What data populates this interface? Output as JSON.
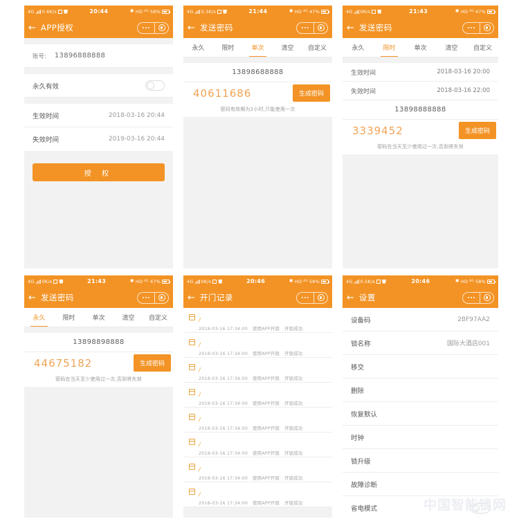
{
  "brand": {
    "accent": "#F39325",
    "code_color": "#F0A355",
    "bg": "#f2f2f2",
    "watermark": "中国智能锁网"
  },
  "icons": {
    "back": "back-arrow-icon",
    "more": "more-dots-icon",
    "target": "target-circle-icon",
    "calendar": "calendar-icon",
    "signal": "signal-bars-icon",
    "battery": "battery-icon",
    "bluetooth": "bluetooth-icon"
  },
  "panels": [
    {
      "id": "app-authorize",
      "status": {
        "net": "4G",
        "speed": "0.6K/s",
        "time": "20:44",
        "hd": "HD",
        "net2": "4G",
        "battery": "58%"
      },
      "nav": {
        "title": "APP授权"
      },
      "account": {
        "label": "账号:",
        "value": "13896888888"
      },
      "rows": [
        {
          "label": "永久有效",
          "value": "",
          "toggle": true
        },
        {
          "label": "生效时间",
          "value": "2018-03-16  20:44",
          "toggle": false
        },
        {
          "label": "失效时间",
          "value": "2019-03-16  20:44",
          "toggle": false
        }
      ],
      "button": "授 权"
    },
    {
      "id": "send-password-single",
      "status": {
        "net": "4G",
        "speed": "0.3K/s",
        "time": "21:44",
        "hd": "HD",
        "net2": "4G",
        "battery": "47%"
      },
      "nav": {
        "title": "发送密码"
      },
      "tabs": [
        {
          "label": "永久",
          "active": false
        },
        {
          "label": "限时",
          "active": false
        },
        {
          "label": "单次",
          "active": true
        },
        {
          "label": "清空",
          "active": false
        },
        {
          "label": "自定义",
          "active": false
        }
      ],
      "phone": "13898688888",
      "code": "40611686",
      "gen_button": "生成密码",
      "hint": "密码有效期为2小时,只能使用一次"
    },
    {
      "id": "send-password-timed",
      "status": {
        "net": "4G",
        "speed": "0K/s",
        "time": "21:43",
        "hd": "HD",
        "net2": "4G",
        "battery": "47%"
      },
      "nav": {
        "title": "发送密码"
      },
      "tabs": [
        {
          "label": "永久",
          "active": false
        },
        {
          "label": "限时",
          "active": true
        },
        {
          "label": "单次",
          "active": false
        },
        {
          "label": "清空",
          "active": false
        },
        {
          "label": "自定义",
          "active": false
        }
      ],
      "kv": [
        {
          "k": "生效时间",
          "v": "2018-03-16 20:00"
        },
        {
          "k": "失效时间",
          "v": "2018-03-16 22:00"
        }
      ],
      "phone": "13898888888",
      "code": "3339452",
      "gen_button": "生成密码",
      "hint": "密码在当天至少使用过一次,否则将失效"
    },
    {
      "id": "send-password-permanent",
      "status": {
        "net": "4G",
        "speed": "0K/s",
        "time": "21:43",
        "hd": "HD",
        "net2": "4G",
        "battery": "47%"
      },
      "nav": {
        "title": "发送密码"
      },
      "tabs": [
        {
          "label": "永久",
          "active": true
        },
        {
          "label": "限时",
          "active": false
        },
        {
          "label": "单次",
          "active": false
        },
        {
          "label": "清空",
          "active": false
        },
        {
          "label": "自定义",
          "active": false
        }
      ],
      "phone": "13898898888",
      "code": "44675182",
      "gen_button": "生成密码",
      "hint": "密码在当天至少使用过一次,否则将失效"
    },
    {
      "id": "door-records",
      "status": {
        "net": "4G",
        "speed": "0K/s",
        "time": "20:46",
        "hd": "HD",
        "net2": "4G",
        "battery": "58%"
      },
      "nav": {
        "title": "开门记录"
      },
      "records": [
        {
          "mark": "/",
          "time": "2018-03-16 17:34:00",
          "action": "使用APP开锁",
          "result": "开锁成功"
        },
        {
          "mark": "/",
          "time": "2018-03-16 17:34:00",
          "action": "使用APP开锁",
          "result": "开锁成功"
        },
        {
          "mark": "/",
          "time": "2018-03-16 17:34:00",
          "action": "使用APP开锁",
          "result": "开锁成功"
        },
        {
          "mark": "/",
          "time": "2018-03-16 17:34:00",
          "action": "使用APP开锁",
          "result": "开锁成功"
        },
        {
          "mark": "/",
          "time": "2018-03-16 17:34:00",
          "action": "使用APP开锁",
          "result": "开锁成功"
        },
        {
          "mark": "/",
          "time": "2018-03-16 17:34:00",
          "action": "使用APP开锁",
          "result": "开锁成功"
        },
        {
          "mark": "/",
          "time": "2018-03-16 17:34:00",
          "action": "使用APP开锁",
          "result": "开锁成功"
        },
        {
          "mark": "/",
          "time": "2018-03-16 17:34:00",
          "action": "使用APP开锁",
          "result": "开锁成功"
        }
      ]
    },
    {
      "id": "settings",
      "status": {
        "net": "4G",
        "speed": "0.5K/s",
        "time": "20:46",
        "hd": "HD",
        "net2": "4G",
        "battery": "58%"
      },
      "nav": {
        "title": "设置"
      },
      "items": [
        {
          "label": "设备码",
          "value": "2BF97AA2",
          "toggle": false
        },
        {
          "label": "锁名称",
          "value": "国际大酒店001",
          "toggle": false
        },
        {
          "label": "移交",
          "value": "",
          "toggle": false
        },
        {
          "label": "删除",
          "value": "",
          "toggle": false
        },
        {
          "label": "恢复默认",
          "value": "",
          "toggle": false
        },
        {
          "label": "时钟",
          "value": "",
          "toggle": false
        },
        {
          "label": "锁升级",
          "value": "",
          "toggle": false
        },
        {
          "label": "故障诊断",
          "value": "",
          "toggle": false
        },
        {
          "label": "省电模式",
          "value": "",
          "toggle": true
        }
      ]
    }
  ]
}
